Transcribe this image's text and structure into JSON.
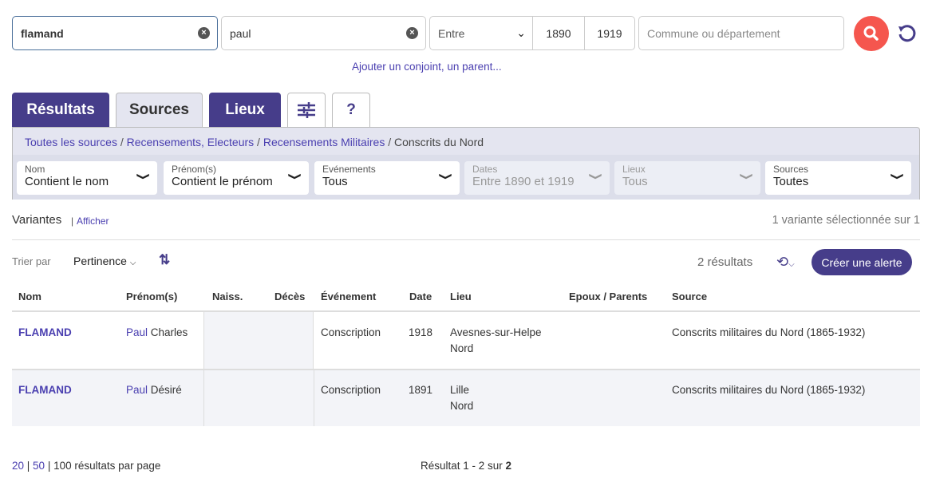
{
  "search": {
    "nom": "flamand",
    "prenom": "paul",
    "period_mode": "Entre",
    "year_from": "1890",
    "year_to": "1919",
    "place_placeholder": "Commune ou département",
    "add_relative": "Ajouter un conjoint, un parent..."
  },
  "tabs": [
    "Résultats",
    "Sources",
    "Lieux"
  ],
  "help_label": "?",
  "breadcrumb": [
    "Toutes les sources",
    "Recensements, Electeurs",
    "Recensements Militaires",
    "Conscrits du Nord"
  ],
  "filters": [
    {
      "label": "Nom",
      "value": "Contient le nom",
      "disabled": false
    },
    {
      "label": "Prénom(s)",
      "value": "Contient le prénom",
      "disabled": false
    },
    {
      "label": "Evénements",
      "value": "Tous",
      "disabled": false
    },
    {
      "label": "Dates",
      "value": "Entre 1890 et 1919",
      "disabled": true
    },
    {
      "label": "Lieux",
      "value": "Tous",
      "disabled": true
    },
    {
      "label": "Sources",
      "value": "Toutes",
      "disabled": false
    }
  ],
  "variants": {
    "label": "Variantes",
    "toggle": "Afficher",
    "status": "1 variante sélectionnée sur 1"
  },
  "sort": {
    "label": "Trier par",
    "value": "Pertinence"
  },
  "results_count": "2 résultats",
  "alert_button": "Créer une alerte",
  "table": {
    "headers": [
      "Nom",
      "Prénom(s)",
      "Naiss.",
      "Décès",
      "Événement",
      "Date",
      "Lieu",
      "Epoux / Parents",
      "Source"
    ],
    "rows": [
      {
        "nom": "FLAMAND",
        "prenom_match": "Paul",
        "prenom_rest": " Charles",
        "evenement": "Conscription",
        "date": "1918",
        "lieu1": "Avesnes-sur-Helpe",
        "lieu2": "Nord",
        "source": "Conscrits militaires du Nord (1865-1932)"
      },
      {
        "nom": "FLAMAND",
        "prenom_match": "Paul",
        "prenom_rest": " Désiré",
        "evenement": "Conscription",
        "date": "1891",
        "lieu1": "Lille",
        "lieu2": "Nord",
        "source": "Conscrits militaires du Nord (1865-1932)"
      }
    ]
  },
  "pagination": {
    "opt1": "20",
    "opt2": "50",
    "rest": "100 résultats par page",
    "summary_prefix": "Résultat 1 - 2 sur ",
    "total": "2"
  },
  "colors": {
    "primary": "#463d8a",
    "link": "#4a3fb0",
    "search": "#f5564e"
  }
}
